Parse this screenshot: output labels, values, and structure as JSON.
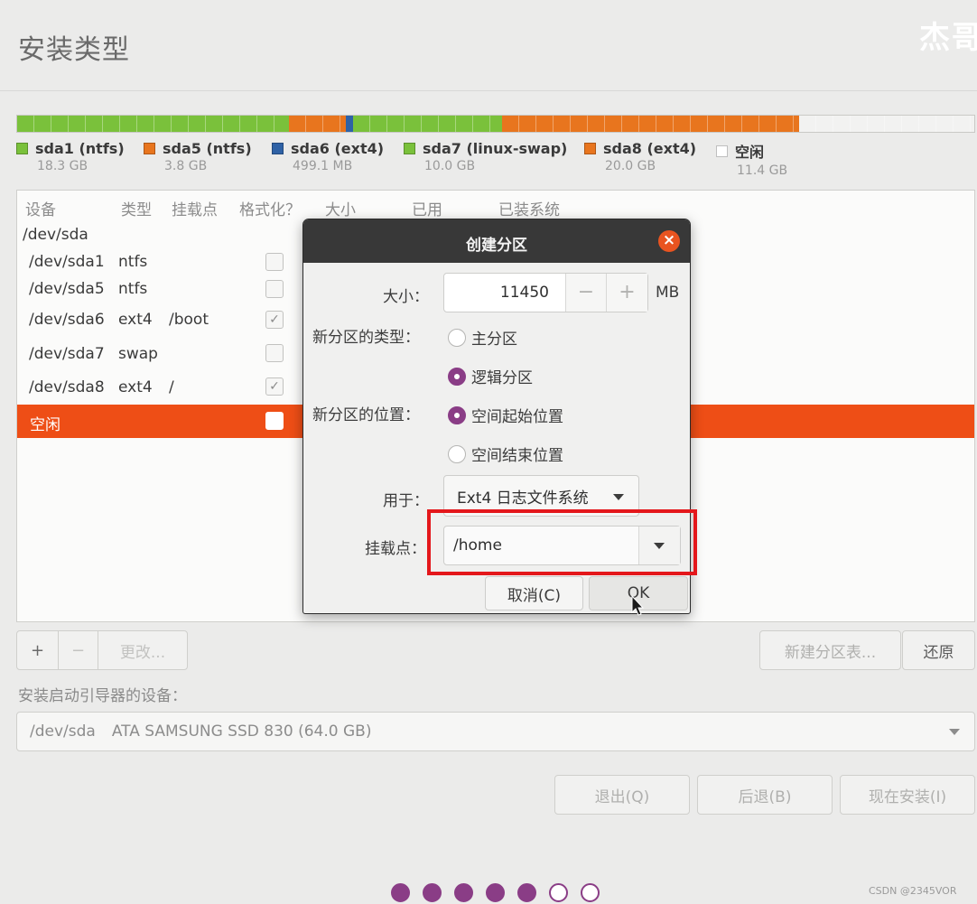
{
  "page": {
    "title": "安装类型",
    "watermark": "杰哥"
  },
  "partition_bar": {
    "segments": [
      {
        "name": "sda1",
        "color": "#7ac13b",
        "fraction": 0.284
      },
      {
        "name": "sda5",
        "color": "#e8751e",
        "fraction": 0.059
      },
      {
        "name": "sda6",
        "color": "#2f62a6",
        "fraction": 0.008
      },
      {
        "name": "sda7",
        "color": "#7ac13b",
        "fraction": 0.156
      },
      {
        "name": "sda8",
        "color": "#e8751e",
        "fraction": 0.31
      },
      {
        "name": "free",
        "color": "#f2f2f1",
        "fraction": 0.183
      }
    ]
  },
  "legend": [
    {
      "label": "sda1 (ntfs)",
      "size": "18.3 GB",
      "color": "#7ac13b"
    },
    {
      "label": "sda5 (ntfs)",
      "size": "3.8 GB",
      "color": "#e8751e"
    },
    {
      "label": "sda6 (ext4)",
      "size": "499.1 MB",
      "color": "#2f62a6"
    },
    {
      "label": "sda7 (linux-swap)",
      "size": "10.0 GB",
      "color": "#7ac13b"
    },
    {
      "label": "sda8 (ext4)",
      "size": "20.0 GB",
      "color": "#e8751e"
    },
    {
      "label": "空闲",
      "size": "11.4 GB",
      "color": "#ffffff"
    }
  ],
  "table": {
    "headers": [
      "设备",
      "类型",
      "挂载点",
      "格式化？",
      "大小",
      "已用",
      "已装系统"
    ],
    "disk": "/dev/sda",
    "rows": [
      {
        "device": "/dev/sda1",
        "type": "ntfs",
        "mount": "",
        "format": false
      },
      {
        "device": "/dev/sda5",
        "type": "ntfs",
        "mount": "",
        "format": false
      },
      {
        "device": "/dev/sda6",
        "type": "ext4",
        "mount": "/boot",
        "format": true
      },
      {
        "device": "/dev/sda7",
        "type": "swap",
        "mount": "",
        "format": false
      },
      {
        "device": "/dev/sda8",
        "type": "ext4",
        "mount": "/",
        "format": true
      }
    ],
    "free_row": {
      "label": "空闲",
      "selected": true
    }
  },
  "toolbar": {
    "add": "+",
    "remove": "−",
    "change": "更改...",
    "new_table": "新建分区表...",
    "revert": "还原"
  },
  "boot_loader": {
    "label": "安装启动引导器的设备：",
    "device": "/dev/sda",
    "model": "ATA SAMSUNG SSD 830 (64.0 GB)"
  },
  "footer": {
    "quit": "退出(Q)",
    "back": "后退(B)",
    "install": "现在安装(I)"
  },
  "progress_dots": {
    "total": 7,
    "filled": 5
  },
  "credit": "CSDN @2345VOR",
  "dialog": {
    "title": "创建分区",
    "size_label": "大小：",
    "size_value": "11450",
    "size_minus": "−",
    "size_plus": "+",
    "size_unit": "MB",
    "type_label": "新分区的类型：",
    "type_primary": "主分区",
    "type_logical": "逻辑分区",
    "type_selected": "逻辑分区",
    "location_label": "新分区的位置：",
    "location_begin": "空间起始位置",
    "location_end": "空间结束位置",
    "location_selected": "空间起始位置",
    "use_label": "用于：",
    "use_value": "Ext4 日志文件系统",
    "mount_label": "挂载点：",
    "mount_value": "/home",
    "cancel": "取消(C)",
    "ok": "OK"
  },
  "colors": {
    "accent": "#e95420",
    "selection": "#ee4e16",
    "aubergine": "#8a3d86",
    "highlight": "#e4171b"
  }
}
